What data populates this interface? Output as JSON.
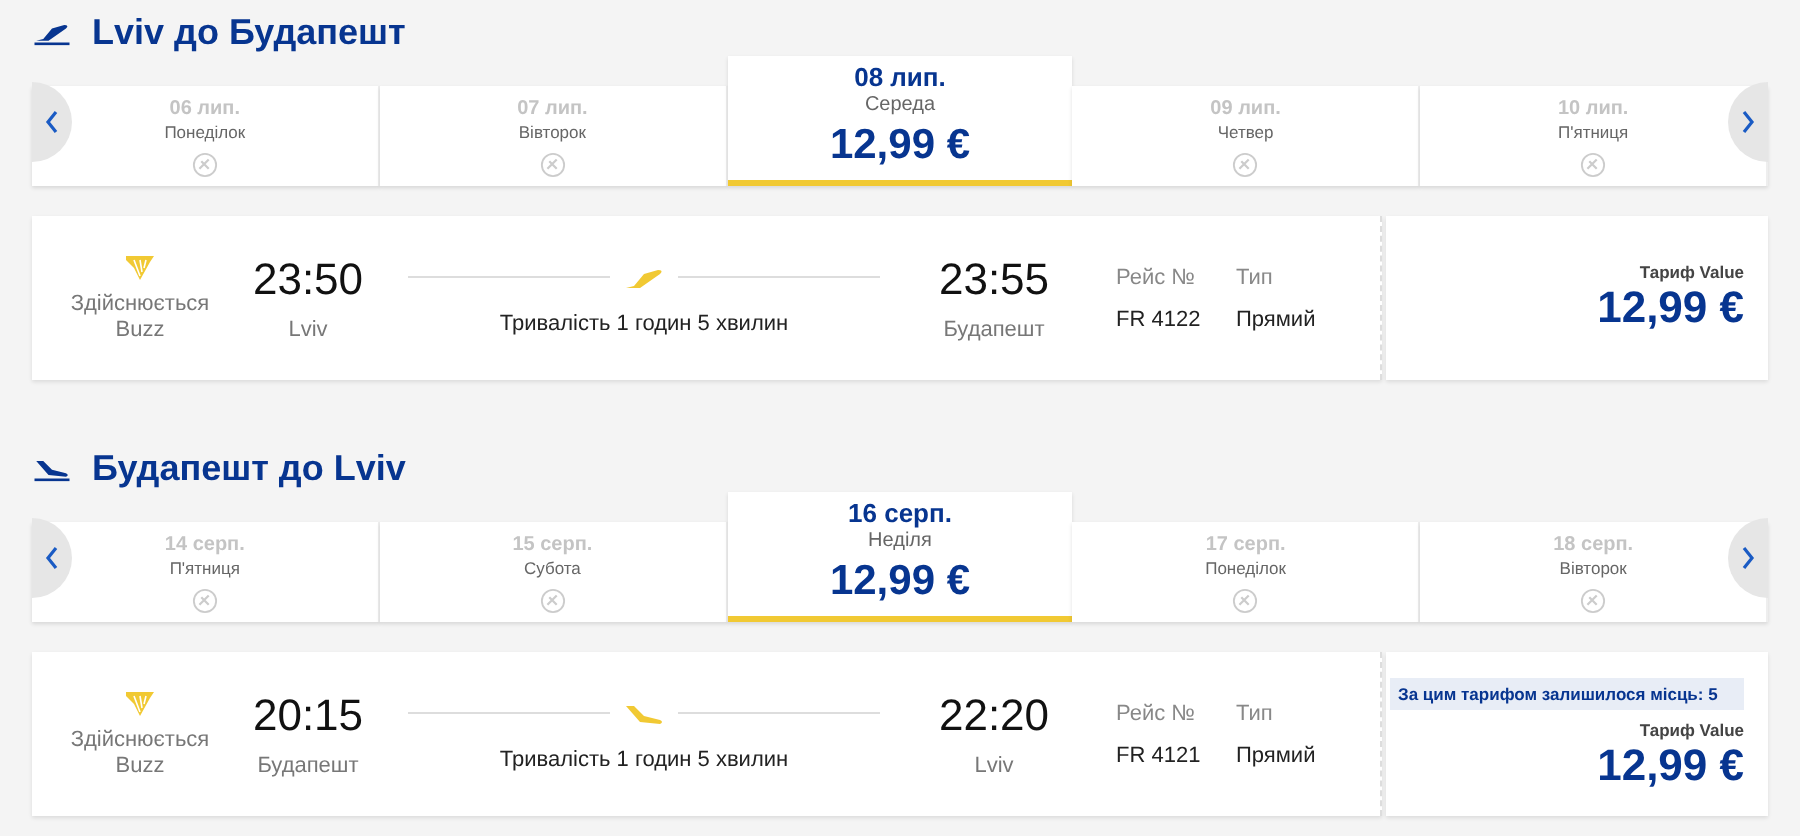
{
  "sections": [
    {
      "kind": "outbound",
      "title": "Lviv до Будапешт",
      "dates": [
        {
          "date": "06 лип.",
          "weekday": "Понеділок",
          "selected": false
        },
        {
          "date": "07 лип.",
          "weekday": "Вівторок",
          "selected": false
        },
        {
          "date": "08 лип.",
          "weekday": "Середа",
          "price": "12,99 €",
          "selected": true
        },
        {
          "date": "09 лип.",
          "weekday": "Четвер",
          "selected": false
        },
        {
          "date": "10 лип.",
          "weekday": "П'ятниця",
          "selected": false
        }
      ],
      "flight": {
        "operated_by": "Здійснюється",
        "carrier": "Buzz",
        "depart_time": "23:50",
        "depart_city": "Lviv",
        "duration": "Тривалість 1 годин 5 хвилин",
        "arrive_time": "23:55",
        "arrive_city": "Будапешт",
        "flight_no_label": "Рейс №",
        "flight_no": "FR 4122",
        "type_label": "Тип",
        "type": "Прямий",
        "fare_label": "Тариф Value",
        "price": "12,99 €"
      }
    },
    {
      "kind": "return",
      "title": "Будапешт до Lviv",
      "dates": [
        {
          "date": "14 серп.",
          "weekday": "П'ятниця",
          "selected": false
        },
        {
          "date": "15 серп.",
          "weekday": "Субота",
          "selected": false
        },
        {
          "date": "16 серп.",
          "weekday": "Неділя",
          "price": "12,99 €",
          "selected": true
        },
        {
          "date": "17 серп.",
          "weekday": "Понеділок",
          "selected": false
        },
        {
          "date": "18 серп.",
          "weekday": "Вівторок",
          "selected": false
        }
      ],
      "flight": {
        "operated_by": "Здійснюється",
        "carrier": "Buzz",
        "depart_time": "20:15",
        "depart_city": "Будапешт",
        "duration": "Тривалість 1 годин 5 хвилин",
        "arrive_time": "22:20",
        "arrive_city": "Lviv",
        "flight_no_label": "Рейс №",
        "flight_no": "FR 4121",
        "type_label": "Тип",
        "type": "Прямий",
        "seats_note": "За цим тарифом залишилося місць: 5",
        "fare_label": "Тариф Value",
        "price": "12,99 €"
      }
    }
  ]
}
